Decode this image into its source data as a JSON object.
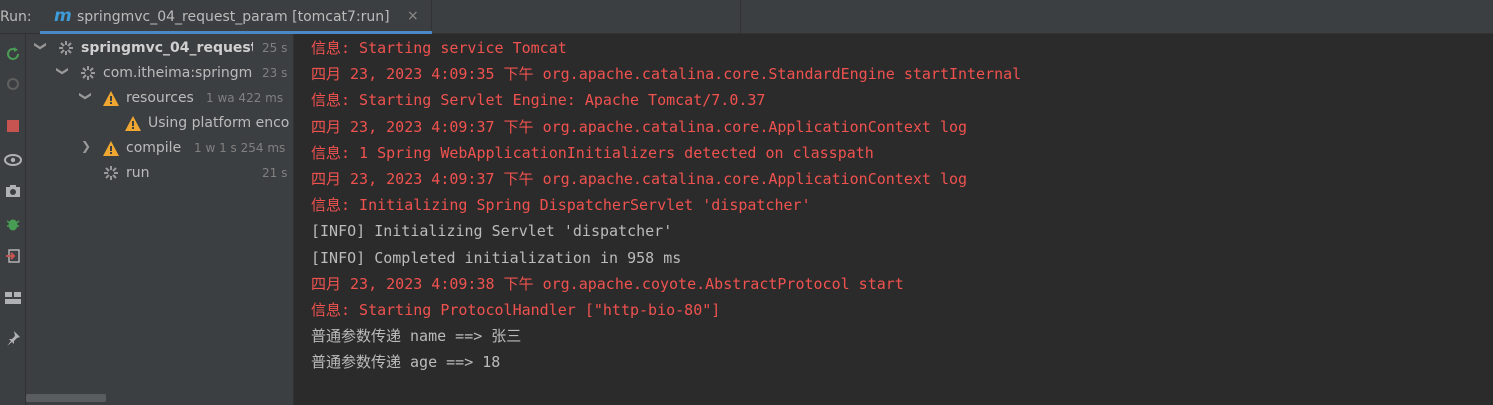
{
  "run_label": "Run:",
  "tab": {
    "icon": "m",
    "title": "springmvc_04_request_param [tomcat7:run]",
    "close": "×"
  },
  "toolbar": [
    "rerun-icon",
    "rerun-failed-icon",
    "stop-icon",
    "eye-icon",
    "camera-icon",
    "debug-bug-icon",
    "exit-icon",
    "layout-icon",
    "pin-icon"
  ],
  "tree": [
    {
      "label": "springmvc_04_request_",
      "duration": "25 s",
      "bold": true
    },
    {
      "label": "com.itheima:springm",
      "duration": "23 s"
    },
    {
      "label": "resources",
      "duration": "1 wa 422 ms"
    },
    {
      "label": "Using platform enco",
      "duration": ""
    },
    {
      "label": "compile",
      "duration": "1 w 1 s 254 ms"
    },
    {
      "label": "run",
      "duration": "21 s"
    }
  ],
  "console": [
    {
      "text": "信息: Starting service Tomcat",
      "color": "#f0524f"
    },
    {
      "text": "四月 23, 2023 4:09:35 下午 org.apache.catalina.core.StandardEngine startInternal",
      "color": "#f0524f"
    },
    {
      "text": "信息: Starting Servlet Engine: Apache Tomcat/7.0.37",
      "color": "#f0524f"
    },
    {
      "text": "四月 23, 2023 4:09:37 下午 org.apache.catalina.core.ApplicationContext log",
      "color": "#f0524f"
    },
    {
      "text": "信息: 1 Spring WebApplicationInitializers detected on classpath",
      "color": "#f0524f"
    },
    {
      "text": "四月 23, 2023 4:09:37 下午 org.apache.catalina.core.ApplicationContext log",
      "color": "#f0524f"
    },
    {
      "text": "信息: Initializing Spring DispatcherServlet 'dispatcher'",
      "color": "#f0524f"
    },
    {
      "text": "[INFO] Initializing Servlet 'dispatcher'",
      "color": "#bbbbbb"
    },
    {
      "text": "[INFO] Completed initialization in 958 ms",
      "color": "#bbbbbb"
    },
    {
      "text": "四月 23, 2023 4:09:38 下午 org.apache.coyote.AbstractProtocol start",
      "color": "#f0524f"
    },
    {
      "text": "信息: Starting ProtocolHandler [\"http-bio-80\"]",
      "color": "#f0524f"
    },
    {
      "text": "普通参数传递 name ==> 张三",
      "color": "#bbbbbb"
    },
    {
      "text": "普通参数传递 age ==> 18",
      "color": "#bbbbbb"
    }
  ]
}
